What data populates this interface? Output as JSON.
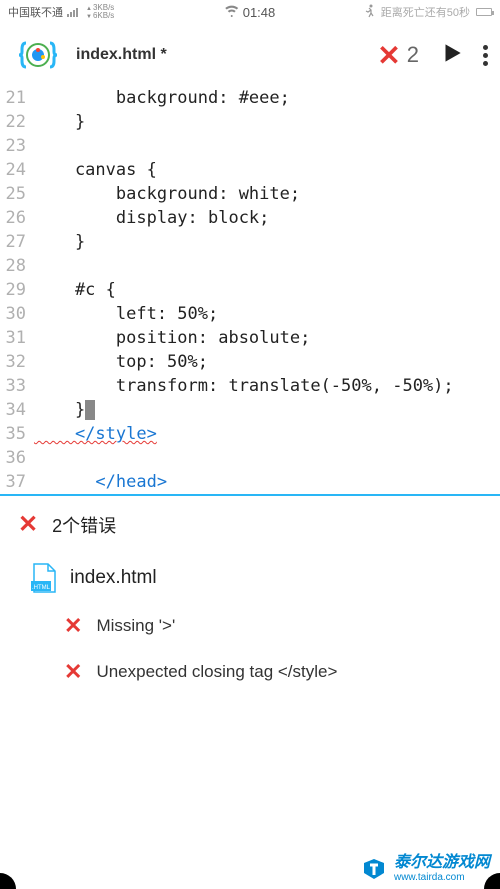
{
  "status": {
    "carrier": "中国联不通",
    "speed_up": "3KB/s",
    "speed_down": "6KB/s",
    "time": "01:48",
    "extra_right": "距离死亡还有50秒"
  },
  "toolbar": {
    "filename": "index.html *",
    "error_count": "2"
  },
  "code_lines": [
    {
      "num": "21",
      "text": "        background: #eee;",
      "cls": ""
    },
    {
      "num": "22",
      "text": "    }",
      "cls": ""
    },
    {
      "num": "23",
      "text": "",
      "cls": ""
    },
    {
      "num": "24",
      "text": "    canvas {",
      "cls": ""
    },
    {
      "num": "25",
      "text": "        background: white;",
      "cls": ""
    },
    {
      "num": "26",
      "text": "        display: block;",
      "cls": ""
    },
    {
      "num": "27",
      "text": "    }",
      "cls": ""
    },
    {
      "num": "28",
      "text": "",
      "cls": ""
    },
    {
      "num": "29",
      "text": "    #c {",
      "cls": ""
    },
    {
      "num": "30",
      "text": "        left: 50%;",
      "cls": ""
    },
    {
      "num": "31",
      "text": "        position: absolute;",
      "cls": ""
    },
    {
      "num": "32",
      "text": "        top: 50%;",
      "cls": ""
    },
    {
      "num": "33",
      "text": "        transform: translate(-50%, -50%);",
      "cls": ""
    },
    {
      "num": "34",
      "text": "    }",
      "cls": "cursor"
    },
    {
      "num": "35",
      "text": "    </style>",
      "cls": "err"
    },
    {
      "num": "36",
      "text": "",
      "cls": ""
    },
    {
      "num": "37",
      "text": "      </head>",
      "cls": "line37"
    }
  ],
  "error_panel": {
    "title": "2个错误",
    "filename": "index.html",
    "errors": [
      "Missing '>'",
      "Unexpected closing tag </style>"
    ]
  },
  "watermark": {
    "brand": "泰尔达游戏网",
    "url": "www.tairda.com"
  }
}
